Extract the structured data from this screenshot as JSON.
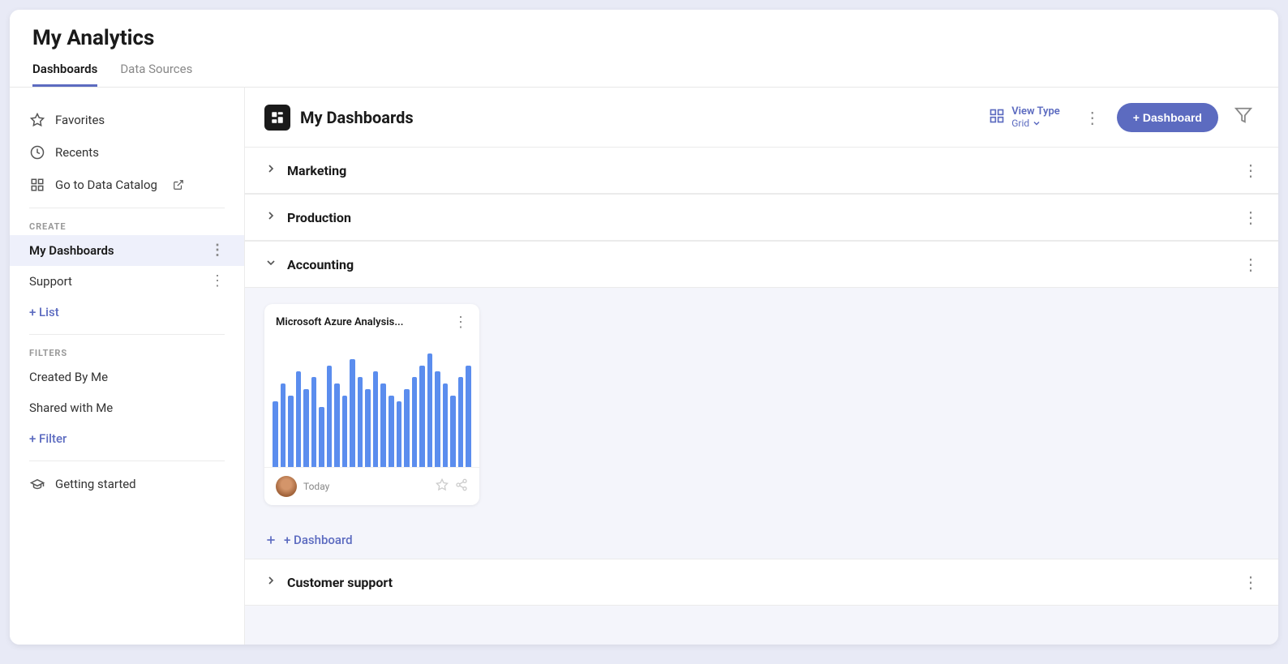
{
  "app": {
    "title": "My Analytics"
  },
  "tabs": [
    {
      "id": "dashboards",
      "label": "Dashboards",
      "active": true
    },
    {
      "id": "data-sources",
      "label": "Data Sources",
      "active": false
    }
  ],
  "sidebar": {
    "items": [
      {
        "id": "favorites",
        "label": "Favorites",
        "icon": "star"
      },
      {
        "id": "recents",
        "label": "Recents",
        "icon": "clock"
      },
      {
        "id": "data-catalog",
        "label": "Go to Data Catalog",
        "icon": "grid",
        "external": true
      }
    ],
    "create_label": "CREATE",
    "create_items": [
      {
        "id": "my-dashboards",
        "label": "My Dashboards",
        "active": true
      },
      {
        "id": "support",
        "label": "Support",
        "active": false
      }
    ],
    "add_list_label": "+ List",
    "filters_label": "FILTERS",
    "filter_items": [
      {
        "id": "created-by-me",
        "label": "Created By Me"
      },
      {
        "id": "shared-with-me",
        "label": "Shared with Me"
      }
    ],
    "add_filter_label": "+ Filter",
    "getting_started": "Getting started"
  },
  "panel": {
    "title": "My Dashboards",
    "view_type_label": "View Type",
    "view_type_value": "Grid",
    "add_button_label": "+ Dashboard",
    "groups": [
      {
        "id": "marketing",
        "label": "Marketing",
        "expanded": false
      },
      {
        "id": "production",
        "label": "Production",
        "expanded": false
      },
      {
        "id": "accounting",
        "label": "Accounting",
        "expanded": true,
        "cards": [
          {
            "id": "azure-analysis",
            "title": "Microsoft Azure Analysis...",
            "date": "Today",
            "bars": [
              55,
              70,
              60,
              80,
              65,
              75,
              50,
              85,
              70,
              60,
              90,
              75,
              65,
              80,
              70,
              60,
              55,
              65,
              75,
              85,
              95,
              80,
              70,
              60,
              75,
              85
            ]
          }
        ]
      },
      {
        "id": "customer-support",
        "label": "Customer support",
        "expanded": false
      }
    ],
    "add_dashboard_link": "+ Dashboard"
  }
}
